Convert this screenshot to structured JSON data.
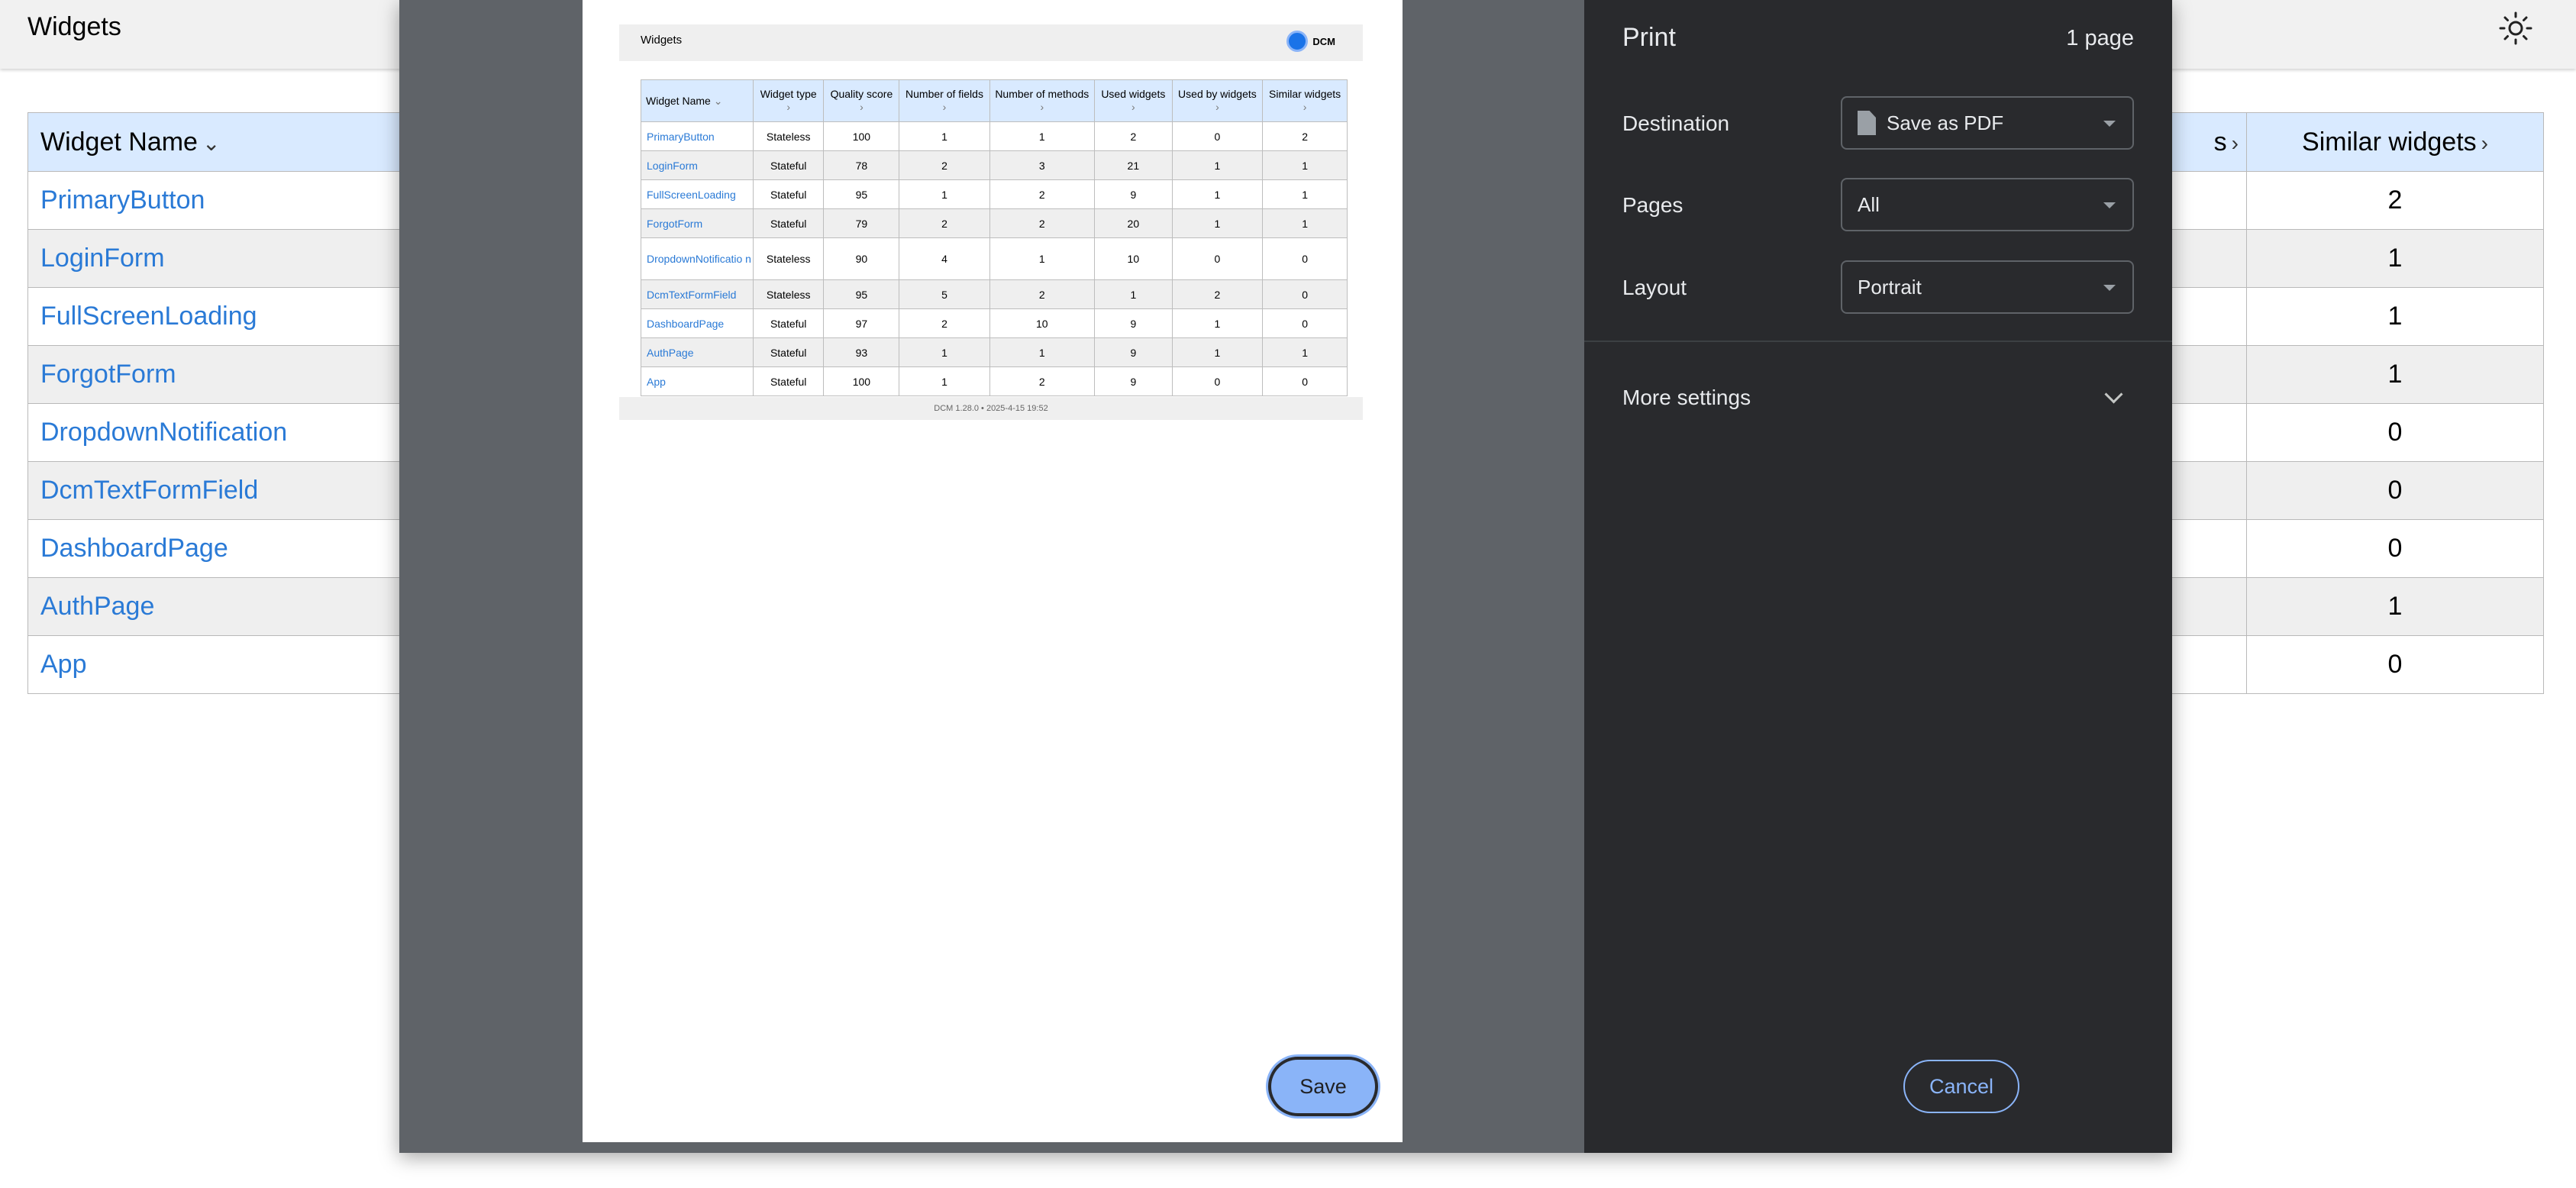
{
  "page": {
    "title": "Widgets",
    "left_table": {
      "header": "Widget Name",
      "rows": [
        "PrimaryButton",
        "LoginForm",
        "FullScreenLoading",
        "ForgotForm",
        "DropdownNotification",
        "DcmTextFormField",
        "DashboardPage",
        "AuthPage",
        "App"
      ]
    },
    "right_table": {
      "partial_header": "s",
      "header": "Similar widgets",
      "values": [
        "2",
        "1",
        "1",
        "1",
        "0",
        "0",
        "0",
        "1",
        "0"
      ]
    }
  },
  "print_preview": {
    "header_title": "Widgets",
    "logo_text": "DCM",
    "columns": [
      "Widget Name",
      "Widget type",
      "Quality score",
      "Number of fields",
      "Number of methods",
      "Used widgets",
      "Used by widgets",
      "Similar widgets"
    ],
    "rows": [
      [
        "PrimaryButton",
        "Stateless",
        "100",
        "1",
        "1",
        "2",
        "0",
        "2"
      ],
      [
        "LoginForm",
        "Stateful",
        "78",
        "2",
        "3",
        "21",
        "1",
        "1"
      ],
      [
        "FullScreenLoading",
        "Stateful",
        "95",
        "1",
        "2",
        "9",
        "1",
        "1"
      ],
      [
        "ForgotForm",
        "Stateful",
        "79",
        "2",
        "2",
        "20",
        "1",
        "1"
      ],
      [
        "DropdownNotificatio n",
        "Stateless",
        "90",
        "4",
        "1",
        "10",
        "0",
        "0"
      ],
      [
        "DcmTextFormField",
        "Stateless",
        "95",
        "5",
        "2",
        "1",
        "2",
        "0"
      ],
      [
        "DashboardPage",
        "Stateful",
        "97",
        "2",
        "10",
        "9",
        "1",
        "0"
      ],
      [
        "AuthPage",
        "Stateful",
        "93",
        "1",
        "1",
        "9",
        "1",
        "1"
      ],
      [
        "App",
        "Stateful",
        "100",
        "1",
        "2",
        "9",
        "0",
        "0"
      ]
    ],
    "footer": "DCM 1.28.0 • 2025-4-15 19:52"
  },
  "print_settings": {
    "title": "Print",
    "page_count": "1 page",
    "destination_label": "Destination",
    "destination_value": "Save as PDF",
    "pages_label": "Pages",
    "pages_value": "All",
    "layout_label": "Layout",
    "layout_value": "Portrait",
    "more_settings": "More settings",
    "cancel": "Cancel",
    "save": "Save"
  },
  "colors": {
    "accent": "#8ab4f8",
    "dialog_bg": "#292a2d",
    "preview_bg": "#5f6368",
    "link": "#2a7ad6",
    "header_cell": "#d9eaff"
  }
}
